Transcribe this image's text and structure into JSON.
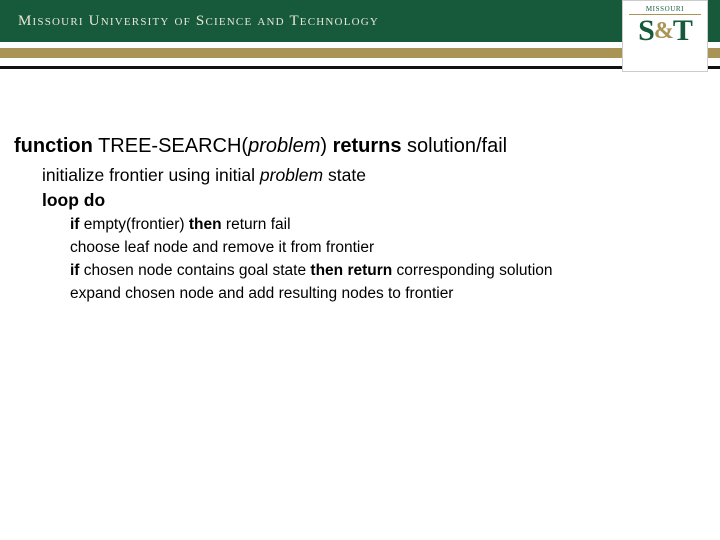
{
  "header": {
    "university_name": "Missouri University of Science and Technology",
    "logo_top": "MISSOURI",
    "logo_s": "S",
    "logo_amp": "&",
    "logo_t": "T"
  },
  "algo": {
    "kw_function": "function",
    "fn_name": " TREE-SEARCH(",
    "fn_arg": "problem",
    "fn_close": ") ",
    "kw_returns": "returns",
    "ret_tail": " solution/fail",
    "line_init_a": "initialize frontier using initial ",
    "line_init_b": "problem",
    "line_init_c": " state",
    "kw_loop": "loop do",
    "l1a": "if ",
    "l1b": "empty(frontier) ",
    "l1c": "then ",
    "l1d": "return fail",
    "l2": "choose leaf node and remove it from frontier",
    "l3a": "if ",
    "l3b": "chosen node contains goal state ",
    "l3c": "then return ",
    "l3d": "corresponding solution",
    "l4": "expand chosen node and add resulting nodes to frontier"
  }
}
